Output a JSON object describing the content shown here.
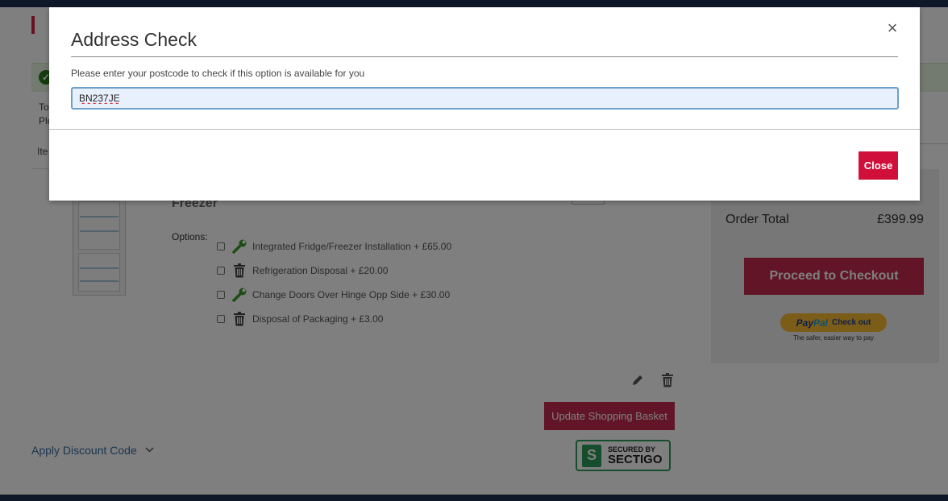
{
  "background": {
    "truncated": {
      "line1": "To",
      "line2": "Ple",
      "items_header": "Ite"
    },
    "product": {
      "title": "Freezer",
      "options_label": "Options:",
      "options": [
        {
          "icon": "wrench-icon",
          "label": "Integrated Fridge/Freezer Installation + £65.00"
        },
        {
          "icon": "trash-icon",
          "label": "Refrigeration Disposal + £20.00"
        },
        {
          "icon": "wrench-icon",
          "label": "Change Doors Over Hinge Opp Side + £30.00"
        },
        {
          "icon": "trash-icon",
          "label": "Disposal of Packaging + £3.00"
        }
      ]
    },
    "update_button": "Update Shopping Basket",
    "sectigo": {
      "small": "SECURED BY",
      "big": "SECTIGO"
    },
    "discount": "Apply Discount Code",
    "summary": {
      "order_total_label": "Order Total",
      "order_total_value": "£399.99",
      "checkout_button": "Proceed to Checkout",
      "paypal": {
        "brand_a": "Pay",
        "brand_b": "Pal",
        "action": "Check out",
        "tagline": "The safer, easier way to pay"
      }
    },
    "colors": {
      "brand": "#c22a4c",
      "nav": "#1f3150",
      "success": "#2b7a1f"
    }
  },
  "modal": {
    "title": "Address Check",
    "description": "Please enter your postcode to check if this option is available for you",
    "postcode_value": "BN237JE",
    "close_button": "Close",
    "close_x": "×"
  }
}
